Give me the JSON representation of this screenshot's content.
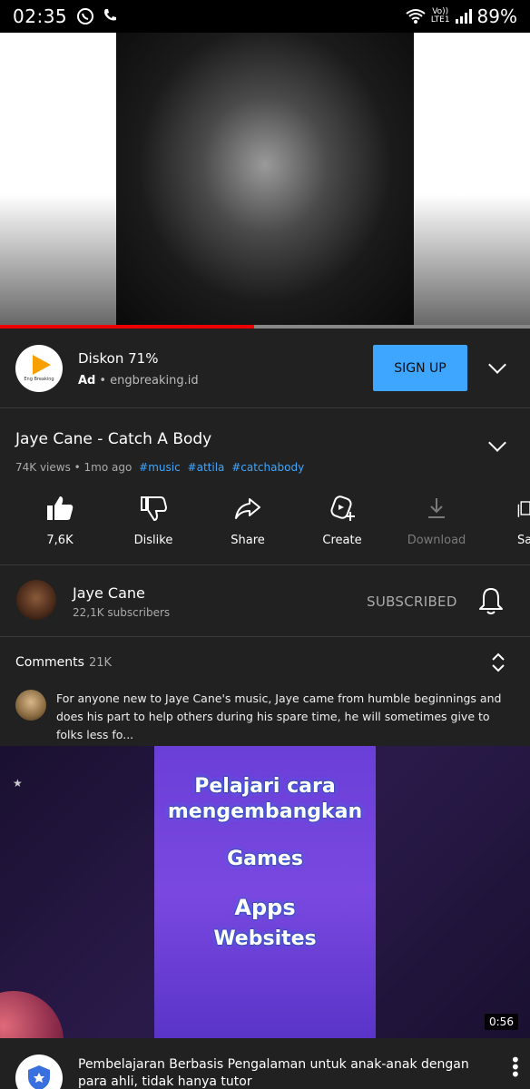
{
  "status_bar": {
    "time": "02:35",
    "volte": "Vo))",
    "lte": "LTE1",
    "battery": "89%"
  },
  "player": {
    "progress_fraction": 0.48
  },
  "ad": {
    "title": "Diskon 71%",
    "ad_label": "Ad",
    "domain": "• engbreaking.id",
    "logo_text": "Eng Breaking",
    "cta_label": "SIGN UP"
  },
  "video": {
    "title": "Jaye Cane - Catch A Body",
    "views": "74K views • 1mo ago",
    "tags": [
      "#music",
      "#attila",
      "#catchabody"
    ]
  },
  "actions": {
    "like_label": "7,6K",
    "dislike_label": "Dislike",
    "share_label": "Share",
    "create_label": "Create",
    "download_label": "Download",
    "save_label": "Sa"
  },
  "channel": {
    "name": "Jaye Cane",
    "subscribers": "22,1K subscribers",
    "subscribed_label": "SUBSCRIBED"
  },
  "comments": {
    "title": "Comments",
    "count": "21K",
    "top_comment": "For anyone new to Jaye Cane's music, Jaye came from humble beginnings and does his part to help others during his spare time, he will sometimes give to folks less fo..."
  },
  "promo": {
    "line1": "Pelajari cara",
    "line2": "mengembangkan",
    "line3": "Games",
    "line4": "Apps",
    "line5": "Websites",
    "duration": "0:56"
  },
  "next_ad": {
    "text": "Pembelajaran Berbasis Pengalaman untuk anak-anak dengan para ahli, tidak hanya tutor"
  },
  "colors": {
    "accent_blue": "#3ea6ff",
    "progress_red": "#ee0000",
    "background": "#212121"
  }
}
